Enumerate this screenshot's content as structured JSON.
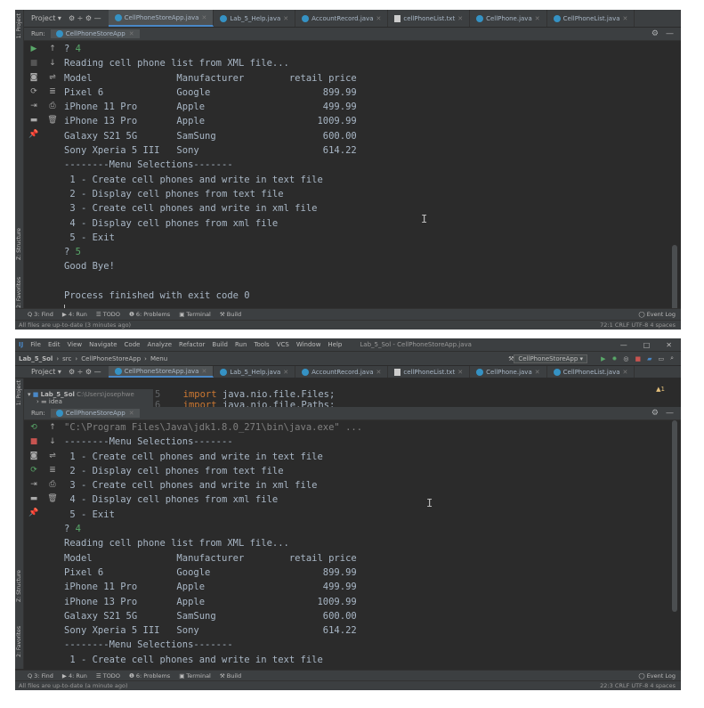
{
  "colors": {
    "ide_bg": "#2b2b2b",
    "panel_bg": "#3c3f41",
    "console_text": "#a9b7c6",
    "user_input": "#59a869",
    "active_tab_underline": "#4a88c7",
    "java_file_icon": "#3592c4"
  },
  "top": {
    "project_menu": "Project ▾",
    "tabs": [
      "CellPhoneStoreApp.java",
      "Lab_5_Help.java",
      "AccountRecord.java",
      "cellPhoneList.txt",
      "CellPhone.java",
      "CellPhoneList.java"
    ],
    "active_tab": 0,
    "run_label": "Run:",
    "run_config_tab": "CellPhoneStoreApp",
    "side_labels": {
      "project": "1: Project",
      "structure": "Z: Structure",
      "favorites": "2: Favorites"
    },
    "console_lines": [
      {
        "text": "? ",
        "input": "4"
      },
      {
        "text": "Reading cell phone list from XML file..."
      },
      {
        "text": "Model               Manufacturer        retail price"
      },
      {
        "text": "Pixel 6             Google                    899.99"
      },
      {
        "text": "iPhone 11 Pro       Apple                     499.99"
      },
      {
        "text": "iPhone 13 Pro       Apple                    1009.99"
      },
      {
        "text": "Galaxy S21 5G       SamSung                   600.00"
      },
      {
        "text": "Sony Xperia 5 III   Sony                      614.22"
      },
      {
        "text": "--------Menu Selections-------"
      },
      {
        "text": " 1 - Create cell phones and write in text file"
      },
      {
        "text": " 2 - Display cell phones from text file"
      },
      {
        "text": " 3 - Create cell phones and write in xml file"
      },
      {
        "text": " 4 - Display cell phones from xml file"
      },
      {
        "text": " 5 - Exit"
      },
      {
        "text": "? ",
        "input": "5"
      },
      {
        "text": "Good Bye!"
      },
      {
        "text": ""
      },
      {
        "text": "Process finished with exit code 0"
      }
    ],
    "toolwindows": [
      "Q  3: Find",
      "▶  4: Run",
      "☰  TODO",
      "❶  6: Problems",
      "▣  Terminal",
      "⚒  Build"
    ],
    "event_log": "Event Log",
    "status_left": "All files are up-to-date (3 minutes ago)",
    "status_right": "72:1   CRLF   UTF-8   4 spaces"
  },
  "bottom": {
    "menu": [
      "File",
      "Edit",
      "View",
      "Navigate",
      "Code",
      "Analyze",
      "Refactor",
      "Build",
      "Run",
      "Tools",
      "VCS",
      "Window",
      "Help"
    ],
    "window_title": "Lab_5_Sol - CellPhoneStoreApp.java",
    "window_controls": [
      "—",
      "□",
      "✕"
    ],
    "breadcrumbs": [
      "Lab_5_Sol",
      "src",
      "CellPhoneStoreApp",
      "Menu"
    ],
    "run_config": "CellPhoneStoreApp ▾",
    "project_menu": "Project ▾",
    "tabs": [
      "CellPhoneStoreApp.java",
      "Lab_5_Help.java",
      "AccountRecord.java",
      "cellPhoneList.txt",
      "CellPhone.java",
      "CellPhoneList.java"
    ],
    "active_tab": 0,
    "project_tree": {
      "root": "Lab_5_Sol",
      "path": "C:\\Users\\josephwe",
      "child": "idea"
    },
    "editor_peek": [
      {
        "line_no": "5",
        "keyword": "import",
        "rest": " java.nio.file.Files;"
      },
      {
        "line_no": "6",
        "keyword": "import",
        "rest": " java.nio.file.Paths;"
      }
    ],
    "warning_badge": "▲1",
    "run_label": "Run:",
    "run_config_tab": "CellPhoneStoreApp",
    "console_lines": [
      {
        "text": "\"C:\\Program Files\\Java\\jdk1.8.0_271\\bin\\java.exe\" ...",
        "style": "gray"
      },
      {
        "text": "--------Menu Selections-------"
      },
      {
        "text": " 1 - Create cell phones and write in text file"
      },
      {
        "text": " 2 - Display cell phones from text file"
      },
      {
        "text": " 3 - Create cell phones and write in xml file"
      },
      {
        "text": " 4 - Display cell phones from xml file"
      },
      {
        "text": " 5 - Exit"
      },
      {
        "text": "? ",
        "input": "4"
      },
      {
        "text": "Reading cell phone list from XML file..."
      },
      {
        "text": "Model               Manufacturer        retail price"
      },
      {
        "text": "Pixel 6             Google                    899.99"
      },
      {
        "text": "iPhone 11 Pro       Apple                     499.99"
      },
      {
        "text": "iPhone 13 Pro       Apple                    1009.99"
      },
      {
        "text": "Galaxy S21 5G       SamSung                   600.00"
      },
      {
        "text": "Sony Xperia 5 III   Sony                      614.22"
      },
      {
        "text": "--------Menu Selections-------"
      },
      {
        "text": " 1 - Create cell phones and write in text file"
      }
    ],
    "toolwindows": [
      "Q  3: Find",
      "▶  4: Run",
      "☰  TODO",
      "❶  6: Problems",
      "▣  Terminal",
      "⚒  Build"
    ],
    "event_log": "Event Log",
    "status_left": "All files are up-to-date (a minute ago)",
    "status_right": "22:3   CRLF   UTF-8   4 spaces"
  }
}
